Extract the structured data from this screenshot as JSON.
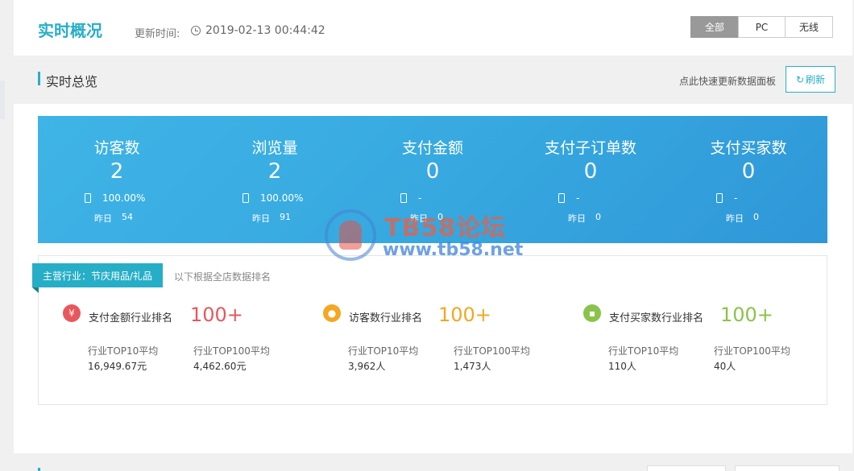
{
  "header": {
    "title": "实时概况",
    "update_label": "更新时间:",
    "update_time": "2019-02-13 00:44:42",
    "tabs": [
      {
        "label": "全部",
        "active": true
      },
      {
        "label": "PC",
        "active": false
      },
      {
        "label": "无线",
        "active": false
      }
    ]
  },
  "overview": {
    "title": "实时总览",
    "refresh_hint": "点此快速更新数据面板",
    "refresh_label": "刷新"
  },
  "stats": [
    {
      "label": "访客数",
      "value": "2",
      "ratio": "100.00%",
      "yesterday_label": "昨日",
      "yesterday": "54"
    },
    {
      "label": "浏览量",
      "value": "2",
      "ratio": "100.00%",
      "yesterday_label": "昨日",
      "yesterday": "91"
    },
    {
      "label": "支付金额",
      "value": "0",
      "ratio": "-",
      "yesterday_label": "昨日",
      "yesterday": "0"
    },
    {
      "label": "支付子订单数",
      "value": "0",
      "ratio": "-",
      "yesterday_label": "昨日",
      "yesterday": "0"
    },
    {
      "label": "支付买家数",
      "value": "0",
      "ratio": "-",
      "yesterday_label": "昨日",
      "yesterday": "0"
    }
  ],
  "industry": {
    "tag": "主营行业：节庆用品/礼品",
    "note": "以下根据全店数据排名",
    "ranks": [
      {
        "icon": "yen-icon",
        "glyph": "¥",
        "color": "#e8575c",
        "title": "支付金额行业排名",
        "rank": "100+",
        "top10_label": "行业TOP10平均",
        "top10": "16,949.67元",
        "top100_label": "行业TOP100平均",
        "top100": "4,462.60元"
      },
      {
        "icon": "user-icon",
        "glyph": "●",
        "color": "#f5a623",
        "title": "访客数行业排名",
        "rank": "100+",
        "top10_label": "行业TOP10平均",
        "top10": "3,962人",
        "top100_label": "行业TOP100平均",
        "top100": "1,473人"
      },
      {
        "icon": "wallet-icon",
        "glyph": "▪",
        "color": "#8bc34a",
        "title": "支付买家数行业排名",
        "rank": "100+",
        "top10_label": "行业TOP10平均",
        "top10": "110人",
        "top100_label": "行业TOP100平均",
        "top100": "40人"
      }
    ]
  },
  "watermark": {
    "line1": "TB58论坛",
    "line2": "www.tb58.net"
  }
}
